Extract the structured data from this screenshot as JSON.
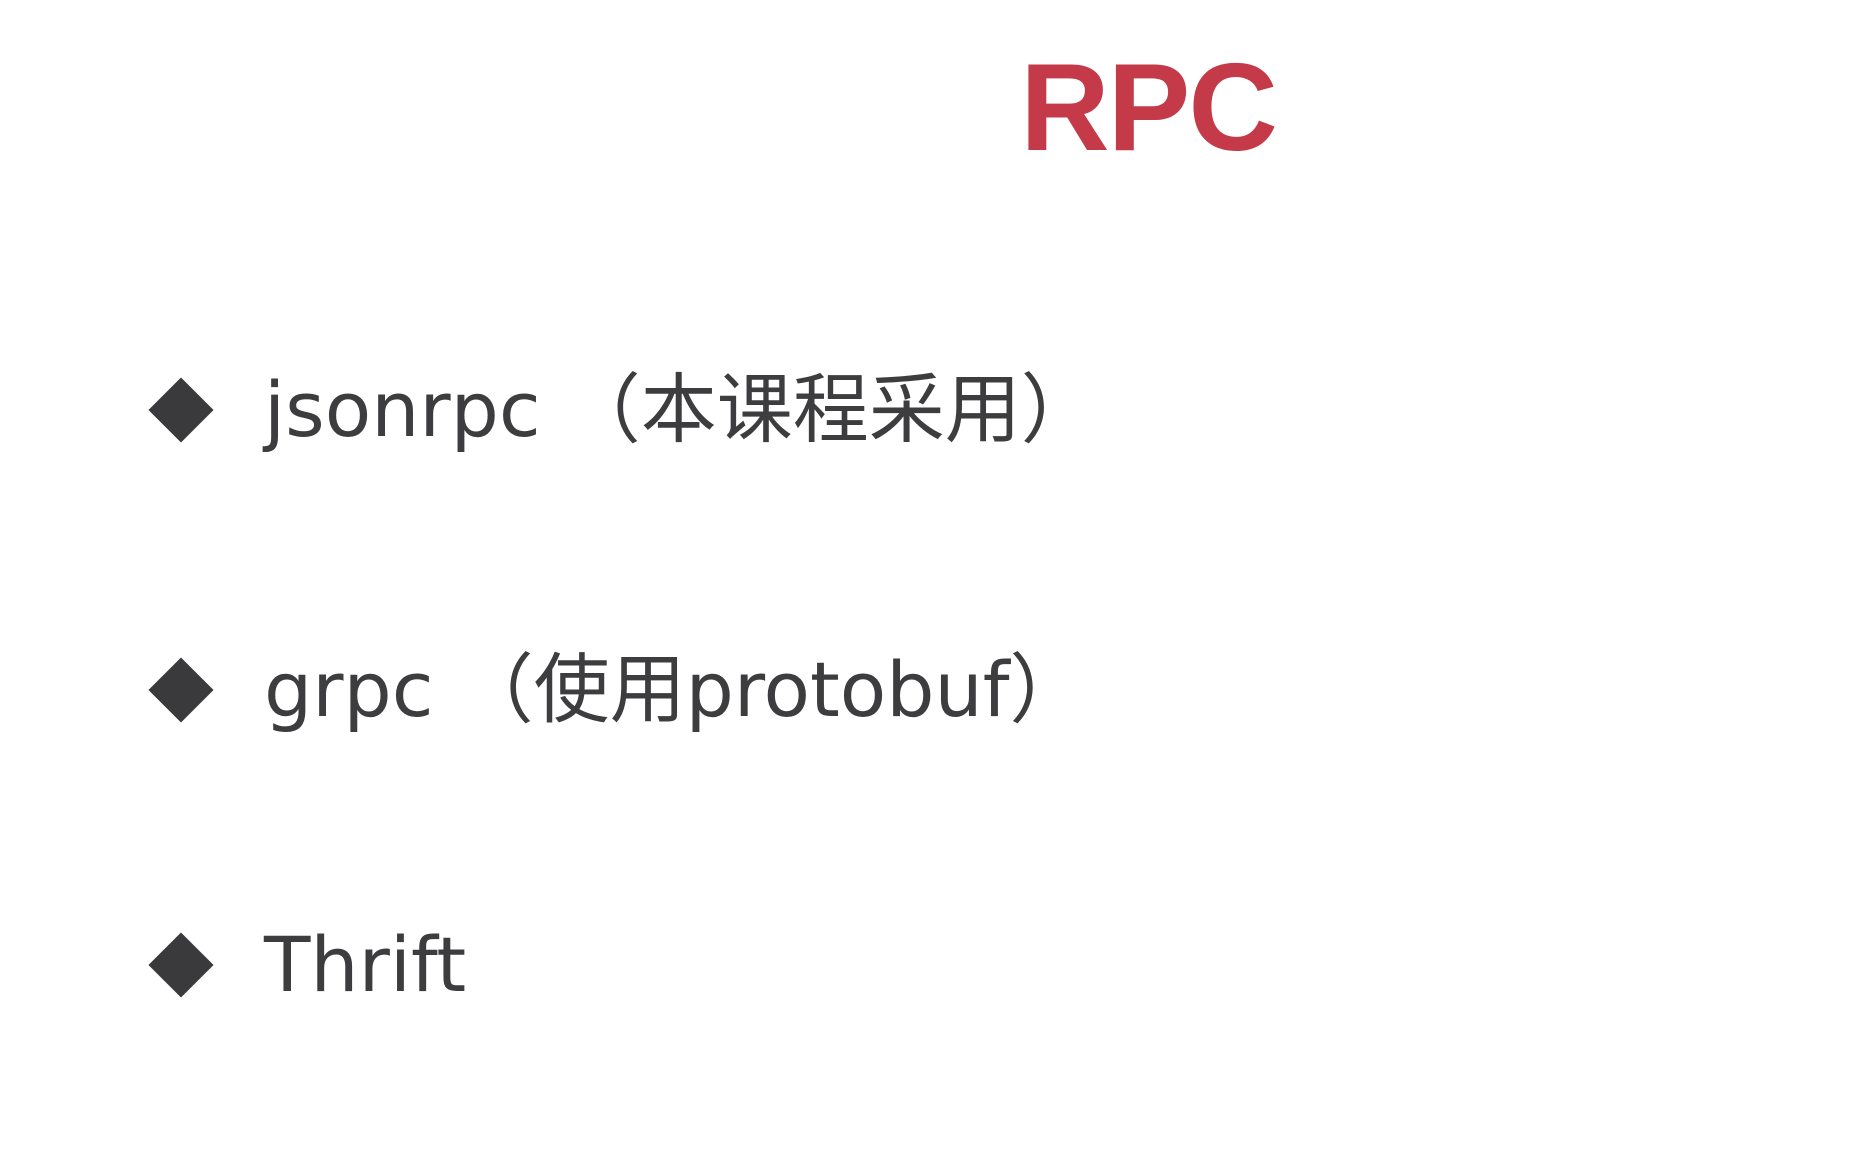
{
  "slide": {
    "title": "RPC",
    "title_color": "#c43a48",
    "text_color": "#3d3d3f",
    "bullet_icon": "black-diamond",
    "items": [
      {
        "label": "jsonrpc （本课程采用）"
      },
      {
        "label": "grpc （使用protobuf）"
      },
      {
        "label": "Thrift"
      }
    ]
  }
}
